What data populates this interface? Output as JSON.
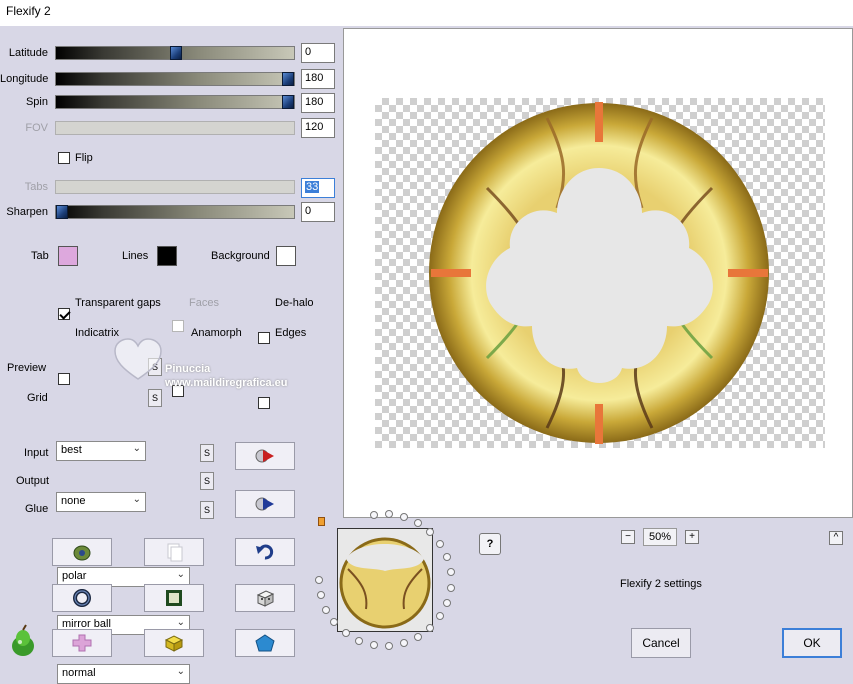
{
  "window": {
    "title": "Flexify 2"
  },
  "sliders": [
    {
      "label": "Latitude",
      "value": "0",
      "level": 0.5,
      "enabled": true
    },
    {
      "label": "Longitude",
      "value": "180",
      "level": 1.0,
      "enabled": true
    },
    {
      "label": "Spin",
      "value": "180",
      "level": 1.0,
      "enabled": true
    },
    {
      "label": "FOV",
      "value": "120",
      "enabled": false
    }
  ],
  "flip": {
    "label": "Flip",
    "checked": false
  },
  "tabs": {
    "label": "Tabs",
    "value": "33",
    "enabled": false
  },
  "sharpen": {
    "label": "Sharpen",
    "value": "0",
    "level": 0
  },
  "colors": {
    "tab": {
      "label": "Tab",
      "color": "#dda8dd"
    },
    "lines": {
      "label": "Lines",
      "color": "#000000"
    },
    "background": {
      "label": "Background",
      "color": "#ffffff"
    }
  },
  "options": {
    "transparent_gaps": {
      "label": "Transparent gaps",
      "checked": true
    },
    "faces": {
      "label": "Faces",
      "checked": false,
      "enabled": false
    },
    "de_halo": {
      "label": "De-halo",
      "checked": false
    },
    "indicatrix": {
      "label": "Indicatrix",
      "checked": false
    },
    "anamorph": {
      "label": "Anamorph",
      "checked": false
    },
    "edges": {
      "label": "Edges",
      "checked": false
    }
  },
  "preview": {
    "label": "Preview",
    "value": "best",
    "s_label": "S"
  },
  "grid": {
    "label": "Grid",
    "value": "none",
    "s_label": "S"
  },
  "input": {
    "label": "Input",
    "value": "polar",
    "s_label": "S"
  },
  "output": {
    "label": "Output",
    "value": "mirror ball",
    "s_label": "S"
  },
  "glue": {
    "label": "Glue",
    "value": "normal",
    "s_label": "S"
  },
  "watermark": {
    "line1": "Pinuccia",
    "line2": "www.maildiregrafica.eu"
  },
  "zoom": {
    "value": "50%",
    "minus": "−",
    "plus": "+"
  },
  "help": {
    "label": "?"
  },
  "collapse": {
    "label": "^"
  },
  "settings_label": "Flexify 2 settings",
  "buttons": {
    "cancel": "Cancel",
    "ok": "OK"
  },
  "accent": "#3c7fd8"
}
